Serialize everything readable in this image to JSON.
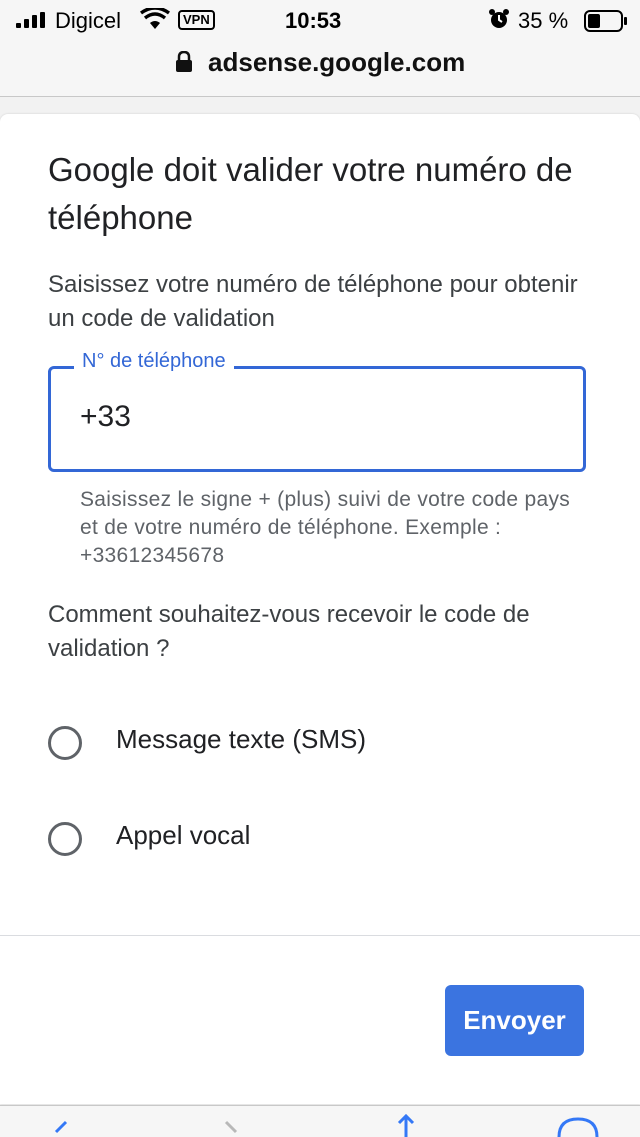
{
  "status_bar": {
    "carrier": "Digicel",
    "vpn": "VPN",
    "time": "10:53",
    "battery_percent": "35 %",
    "icons": [
      "signal-icon",
      "wifi-icon",
      "alarm-icon",
      "battery-icon"
    ]
  },
  "browser": {
    "url": "adsense.google.com"
  },
  "dialog": {
    "title": "Google doit valider votre numéro de téléphone",
    "subtitle": "Saisissez votre numéro de téléphone pour obtenir un code de validation",
    "phone_field": {
      "label": "N° de téléphone",
      "value": "+33"
    },
    "helper_text": "Saisissez le signe + (plus) suivi de votre code pays et de votre numéro de téléphone. Exemple : +33612345678",
    "question": "Comment souhaitez-vous recevoir le code de validation ?",
    "options": [
      {
        "label": "Message texte (SMS)",
        "selected": false
      },
      {
        "label": "Appel vocal",
        "selected": false
      }
    ],
    "send_label": "Envoyer"
  },
  "colors": {
    "accent": "#3367d6",
    "button": "#3b74e0",
    "text": "#202124",
    "secondary_text": "#5f6368"
  }
}
